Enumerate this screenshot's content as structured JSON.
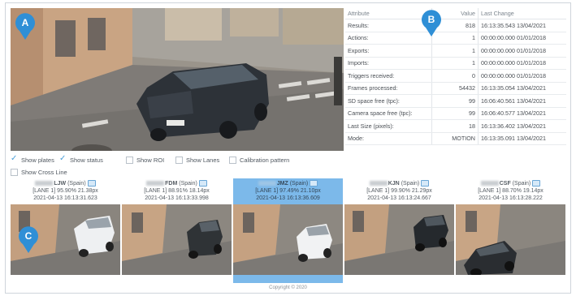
{
  "markers": {
    "a": "A",
    "b": "B",
    "c": "C"
  },
  "table": {
    "headers": {
      "attribute": "Attribute",
      "value": "Value",
      "last_change": "Last Change"
    },
    "rows": [
      {
        "attribute": "Results:",
        "value": "818",
        "last_change": "16:13:35.543 13/04/2021"
      },
      {
        "attribute": "Actions:",
        "value": "1",
        "last_change": "00:00:00.000 01/01/2018"
      },
      {
        "attribute": "Exports:",
        "value": "1",
        "last_change": "00:00:00.000 01/01/2018"
      },
      {
        "attribute": "Imports:",
        "value": "1",
        "last_change": "00:00:00.000 01/01/2018"
      },
      {
        "attribute": "Triggers received:",
        "value": "0",
        "last_change": "00:00:00.000 01/01/2018"
      },
      {
        "attribute": "Frames processed:",
        "value": "54432",
        "last_change": "16:13:35.054 13/04/2021"
      },
      {
        "attribute": "SD space free (tpc):",
        "value": "99",
        "last_change": "16:06:40.561 13/04/2021"
      },
      {
        "attribute": "Camera space free (tpc):",
        "value": "99",
        "last_change": "16:06:40.577 13/04/2021"
      },
      {
        "attribute": "Last Size (pixels):",
        "value": "18",
        "last_change": "16:13:36.402 13/04/2021"
      },
      {
        "attribute": "Mode:",
        "value": "MOTION",
        "last_change": "16:13:35.091 13/04/2021"
      }
    ]
  },
  "options": [
    {
      "label": "Show plates",
      "checked": true
    },
    {
      "label": "Show status",
      "checked": true
    },
    {
      "label": "Show ROI",
      "checked": false
    },
    {
      "label": "Show Lanes",
      "checked": false
    },
    {
      "label": "Calibration pattern",
      "checked": false
    },
    {
      "label": "Show Cross Line",
      "checked": false
    }
  ],
  "detections": [
    {
      "plate_suffix": "LJW",
      "country": "(Spain)",
      "line2": "[LANE 1] 95.90% 21.38px",
      "timestamp": "2021-04-13 16:13:31.623",
      "selected": false
    },
    {
      "plate_suffix": "FDM",
      "country": "(Spain)",
      "line2": "[LANE 1] 88.91% 18.14px",
      "timestamp": "2021-04-13 16:13:33.998",
      "selected": false
    },
    {
      "plate_suffix": "JMZ",
      "country": "(Spain)",
      "line2": "[LANE 1] 97.49% 21.10px",
      "timestamp": "2021-04-13 16:13:36.609",
      "selected": true
    },
    {
      "plate_suffix": "KJN",
      "country": "(Spain)",
      "line2": "[LANE 1] 99.90% 21.29px",
      "timestamp": "2021-04-13 16:13:24.667",
      "selected": false
    },
    {
      "plate_suffix": "CSF",
      "country": "(Spain)",
      "line2": "[LANE 1] 88.70% 19.14px",
      "timestamp": "2021-04-13 16:13:28.222",
      "selected": false
    }
  ],
  "copyright": "Copyright © 2020",
  "colors": {
    "marker": "#2f8fd6",
    "selected": "#7cb9ea",
    "check": "#4a9fd8"
  }
}
